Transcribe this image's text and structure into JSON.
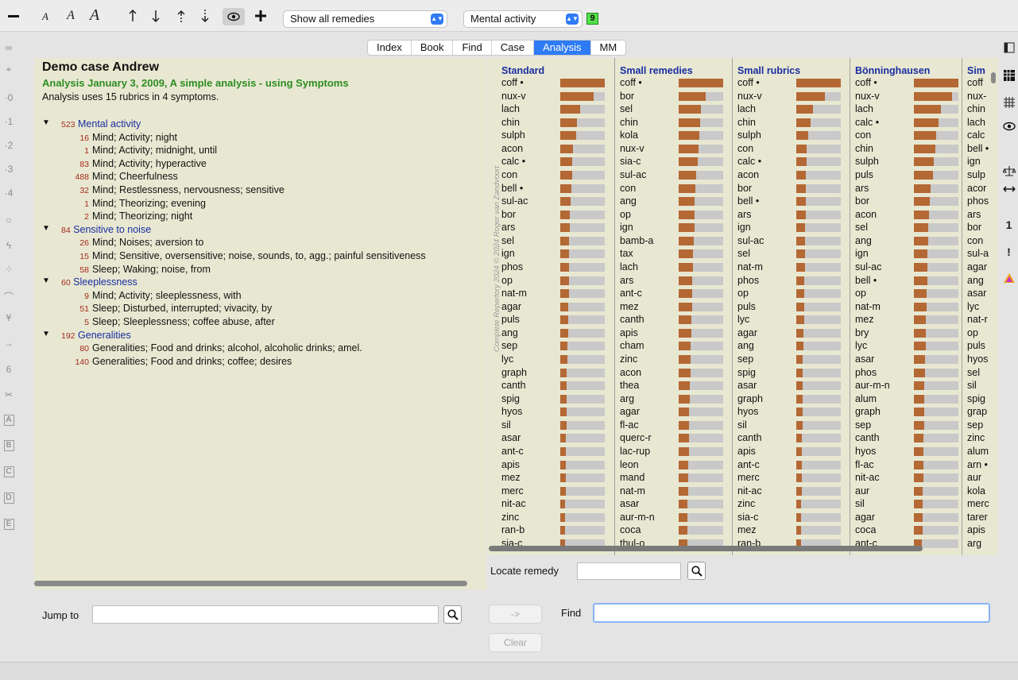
{
  "toolbar": {
    "selectRemedies": "Show all remedies",
    "selectSymptom": "Mental activity",
    "badge": "9"
  },
  "tabs": [
    {
      "label": "Index",
      "active": false
    },
    {
      "label": "Book",
      "active": false
    },
    {
      "label": "Find",
      "active": false
    },
    {
      "label": "Case",
      "active": false
    },
    {
      "label": "Analysis",
      "active": true
    },
    {
      "label": "MM",
      "active": false
    }
  ],
  "leftRail": {
    "items": [
      "∞",
      "⌖",
      "·0",
      "·1",
      "·2",
      "·3",
      "·4",
      "○",
      "ϟ",
      "⁘",
      "⌒",
      "Ұ",
      "→",
      "6",
      "✂"
    ],
    "boxes": [
      "A",
      "B",
      "C",
      "D",
      "E"
    ]
  },
  "rightRail": {
    "iconNames": [
      "sidebar-layout-icon",
      "grid-icon",
      "hatched-grid-icon",
      "eye-icon",
      "balance-icon",
      "arrows-horizontal-icon",
      "number-one-icon",
      "exclamation-icon",
      "triangle-icon"
    ],
    "numberLabel": "1",
    "exclamationLabel": "!"
  },
  "case": {
    "title": "Demo case Andrew",
    "analysisTitle": "Analysis January 3, 2009, A simple analysis - using Symptoms",
    "info": "Analysis uses 15 rubrics in 4 symptoms."
  },
  "symptoms": [
    {
      "count": "523",
      "name": "Mental activity",
      "rubrics": [
        {
          "count": "16",
          "text": "Mind; Activity; night"
        },
        {
          "count": "1",
          "text": "Mind; Activity; midnight, until"
        },
        {
          "count": "83",
          "text": "Mind; Activity; hyperactive"
        },
        {
          "count": "488",
          "text": "Mind; Cheerfulness"
        },
        {
          "count": "32",
          "text": "Mind; Restlessness, nervousness; sensitive"
        },
        {
          "count": "1",
          "text": "Mind; Theorizing; evening"
        },
        {
          "count": "2",
          "text": "Mind; Theorizing; night"
        }
      ]
    },
    {
      "count": "84",
      "name": "Sensitive to noise",
      "rubrics": [
        {
          "count": "26",
          "text": "Mind; Noises; aversion to"
        },
        {
          "count": "15",
          "text": "Mind; Sensitive, oversensitive; noise, sounds, to, agg.; painful sensitiveness"
        },
        {
          "count": "58",
          "text": "Sleep; Waking; noise, from"
        }
      ]
    },
    {
      "count": "60",
      "name": "Sleeplessness",
      "rubrics": [
        {
          "count": "9",
          "text": "Mind; Activity; sleeplessness, with"
        },
        {
          "count": "51",
          "text": "Sleep; Disturbed, interrupted; vivacity, by"
        },
        {
          "count": "5",
          "text": "Sleep; Sleeplessness; coffee abuse, after"
        }
      ]
    },
    {
      "count": "192",
      "name": "Generalities",
      "rubrics": [
        {
          "count": "80",
          "text": "Generalities; Food and drinks; alcohol, alcoholic drinks; amel."
        },
        {
          "count": "140",
          "text": "Generalities; Food and drinks; coffee; desires"
        }
      ]
    }
  ],
  "analysis": {
    "copyright": "Complete Repertory 2024 © 2024 Roger van Zandvoort",
    "columns": [
      {
        "title": "Standard",
        "remedies": [
          "coff •",
          "nux-v",
          "lach",
          "chin",
          "sulph",
          "acon",
          "calc •",
          "con",
          "bell •",
          "sul-ac",
          "bor",
          "ars",
          "sel",
          "ign",
          "phos",
          "op",
          "nat-m",
          "agar",
          "puls",
          "ang",
          "sep",
          "lyc",
          "graph",
          "canth",
          "spig",
          "hyos",
          "sil",
          "asar",
          "ant-c",
          "apis",
          "mez",
          "merc",
          "nit-ac",
          "zinc",
          "ran-b",
          "sia-c"
        ],
        "scores": [
          1.0,
          0.75,
          0.45,
          0.38,
          0.36,
          0.28,
          0.27,
          0.26,
          0.25,
          0.23,
          0.22,
          0.21,
          0.2,
          0.2,
          0.2,
          0.19,
          0.19,
          0.18,
          0.18,
          0.17,
          0.16,
          0.16,
          0.15,
          0.15,
          0.15,
          0.14,
          0.14,
          0.13,
          0.13,
          0.12,
          0.12,
          0.12,
          0.11,
          0.11,
          0.1,
          0.1
        ]
      },
      {
        "title": "Small remedies",
        "remedies": [
          "coff •",
          "bor",
          "sel",
          "chin",
          "kola",
          "nux-v",
          "sia-c",
          "sul-ac",
          "con",
          "ang",
          "op",
          "ign",
          "bamb-a",
          "tax",
          "lach",
          "ars",
          "ant-c",
          "mez",
          "canth",
          "apis",
          "cham",
          "zinc",
          "acon",
          "thea",
          "arg",
          "agar",
          "fl-ac",
          "querc-r",
          "lac-rup",
          "leon",
          "mand",
          "nat-m",
          "asar",
          "aur-m-n",
          "coca",
          "thul-o"
        ],
        "scores": [
          1.0,
          0.6,
          0.5,
          0.48,
          0.46,
          0.45,
          0.42,
          0.4,
          0.38,
          0.36,
          0.35,
          0.35,
          0.34,
          0.33,
          0.32,
          0.31,
          0.3,
          0.3,
          0.29,
          0.28,
          0.27,
          0.27,
          0.26,
          0.25,
          0.25,
          0.24,
          0.24,
          0.23,
          0.23,
          0.22,
          0.22,
          0.21,
          0.2,
          0.2,
          0.19,
          0.19
        ]
      },
      {
        "title": "Small rubrics",
        "remedies": [
          "coff •",
          "nux-v",
          "lach",
          "chin",
          "sulph",
          "con",
          "calc •",
          "acon",
          "bor",
          "bell •",
          "ars",
          "ign",
          "sul-ac",
          "sel",
          "nat-m",
          "phos",
          "op",
          "puls",
          "lyc",
          "agar",
          "ang",
          "sep",
          "spig",
          "asar",
          "graph",
          "hyos",
          "sil",
          "canth",
          "apis",
          "ant-c",
          "merc",
          "nit-ac",
          "zinc",
          "sia-c",
          "mez",
          "ran-b"
        ],
        "scores": [
          1.0,
          0.65,
          0.38,
          0.32,
          0.26,
          0.24,
          0.23,
          0.22,
          0.22,
          0.21,
          0.21,
          0.2,
          0.2,
          0.19,
          0.19,
          0.18,
          0.18,
          0.17,
          0.17,
          0.16,
          0.16,
          0.15,
          0.15,
          0.15,
          0.14,
          0.14,
          0.14,
          0.13,
          0.13,
          0.12,
          0.12,
          0.12,
          0.11,
          0.11,
          0.1,
          0.1
        ]
      },
      {
        "title": "Bönninghausen",
        "remedies": [
          "coff •",
          "nux-v",
          "lach",
          "calc •",
          "con",
          "chin",
          "sulph",
          "puls",
          "ars",
          "bor",
          "acon",
          "sel",
          "ang",
          "ign",
          "sul-ac",
          "bell •",
          "op",
          "nat-m",
          "mez",
          "bry",
          "lyc",
          "asar",
          "phos",
          "aur-m-n",
          "alum",
          "graph",
          "sep",
          "canth",
          "hyos",
          "fl-ac",
          "nit-ac",
          "aur",
          "sil",
          "agar",
          "coca",
          "ant-c"
        ],
        "scores": [
          1.0,
          0.85,
          0.6,
          0.55,
          0.5,
          0.48,
          0.45,
          0.42,
          0.38,
          0.36,
          0.34,
          0.33,
          0.32,
          0.31,
          0.3,
          0.3,
          0.29,
          0.28,
          0.27,
          0.27,
          0.26,
          0.25,
          0.25,
          0.24,
          0.24,
          0.23,
          0.23,
          0.22,
          0.22,
          0.21,
          0.21,
          0.2,
          0.2,
          0.19,
          0.19,
          0.18
        ]
      },
      {
        "title": "Sim",
        "remedies": [
          "coff",
          "nux-",
          "chin",
          "lach",
          "calc",
          "bell •",
          "ign",
          "sulp",
          "acor",
          "phos",
          "ars",
          "bor",
          "con",
          "sul-a",
          "agar",
          "ang",
          "asar",
          "lyc",
          "nat-r",
          "op",
          "puls",
          "hyos",
          "sel",
          "sil",
          "spig",
          "grap",
          "sep",
          "zinc",
          "alum",
          "arn •",
          "aur",
          "kola",
          "merc",
          "tarer",
          "apis",
          "arg"
        ],
        "scores": []
      }
    ]
  },
  "locate": {
    "label": "Locate remedy",
    "value": ""
  },
  "bottom": {
    "jumpLabel": "Jump to",
    "jumpValue": "",
    "arrowButton": "->",
    "findLabel": "Find",
    "findValue": "",
    "clearButton": "Clear"
  }
}
